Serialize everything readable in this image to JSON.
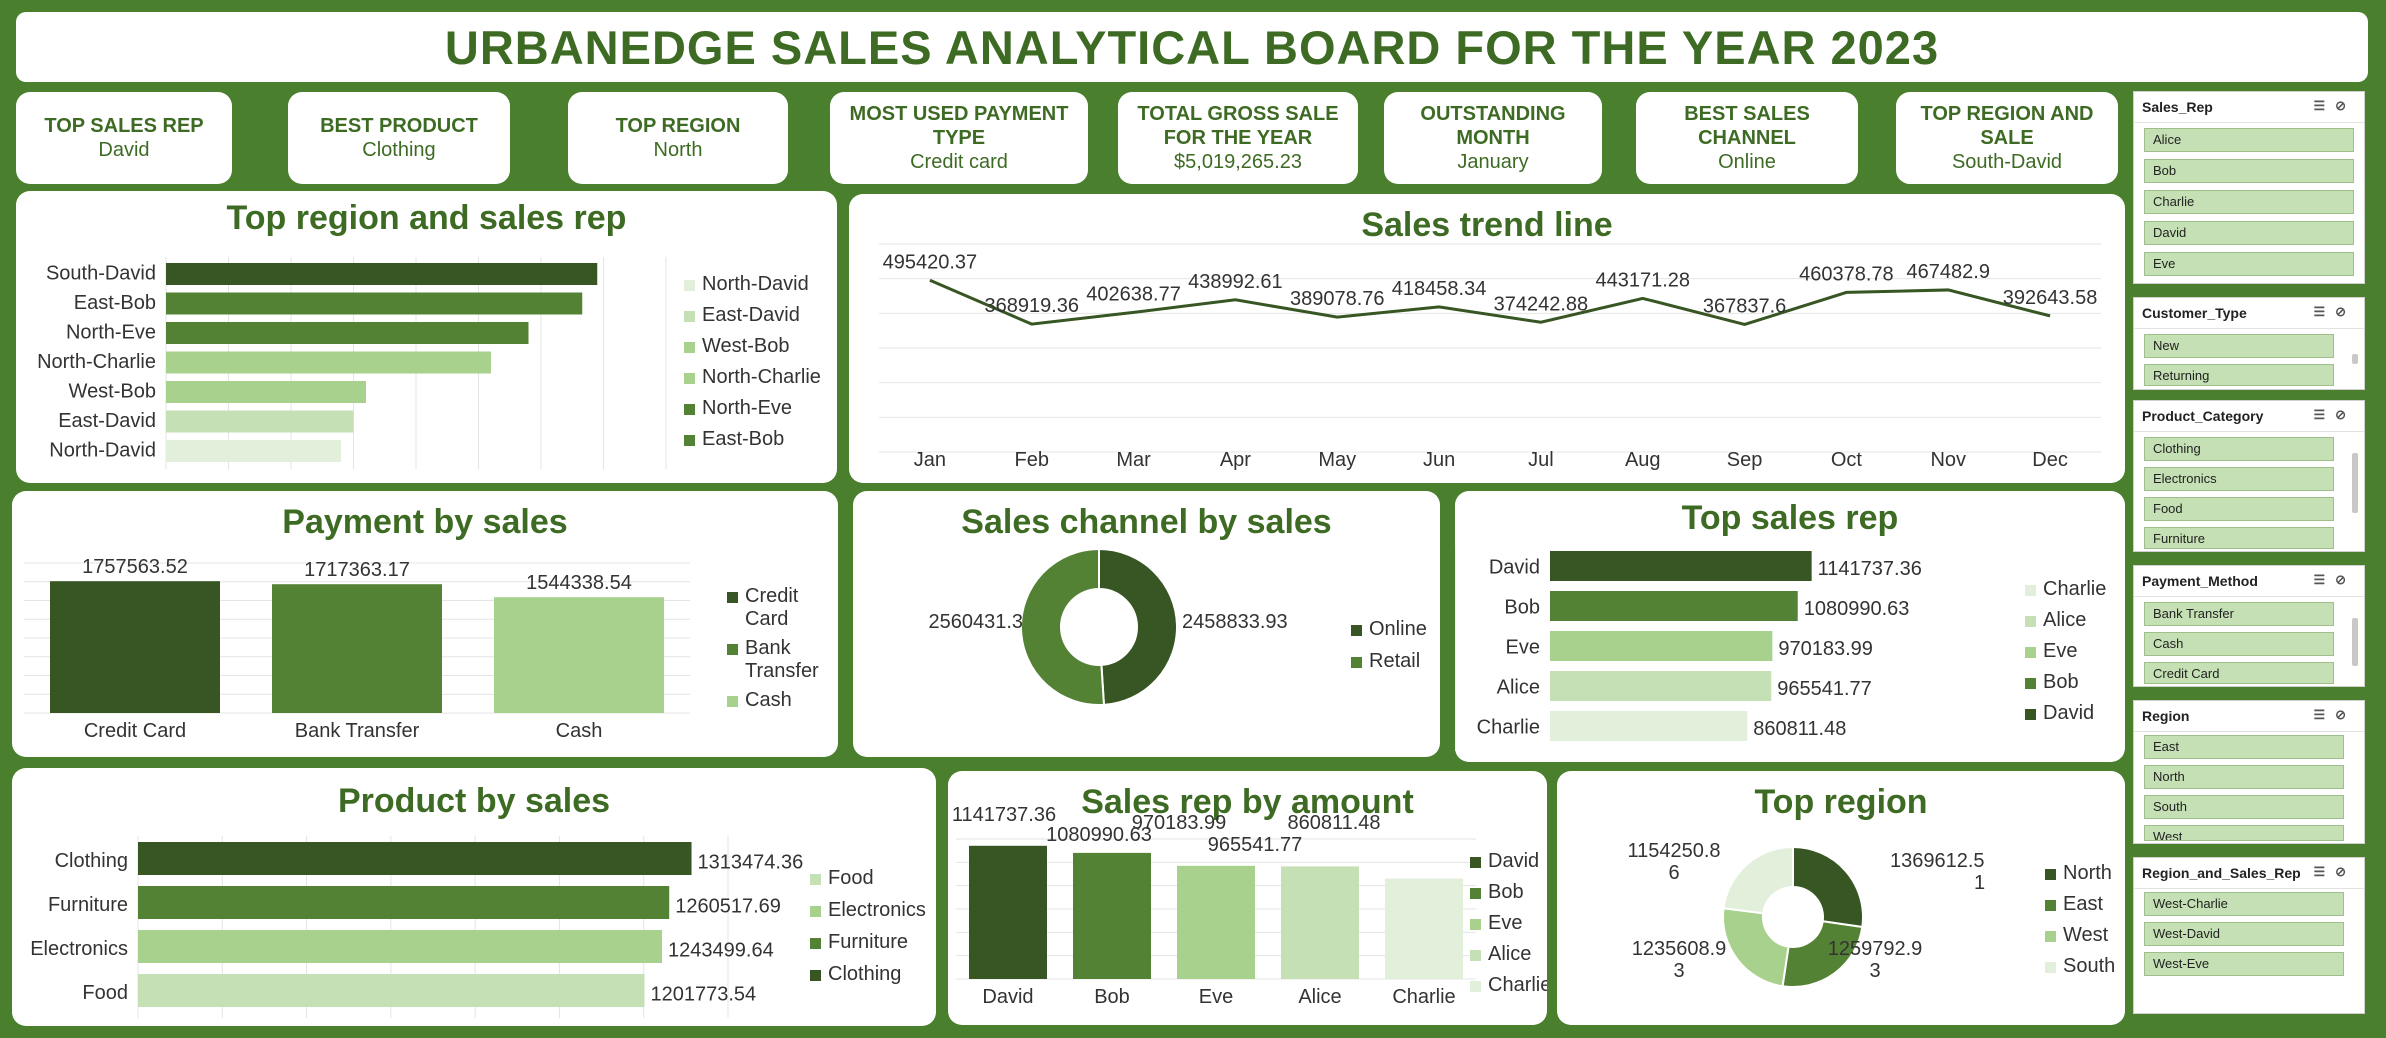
{
  "title": "URBANEDGE SALES ANALYTICAL BOARD FOR THE YEAR 2023",
  "kpis": [
    {
      "label": "TOP SALES REP",
      "value": "David"
    },
    {
      "label": "BEST PRODUCT",
      "value": "Clothing"
    },
    {
      "label": "TOP REGION",
      "value": "North"
    },
    {
      "label": "MOST USED PAYMENT TYPE",
      "value": "Credit card"
    },
    {
      "label": "TOTAL GROSS SALE FOR THE YEAR",
      "value": "$5,019,265.23"
    },
    {
      "label": "OUTSTANDING MONTH",
      "value": "January"
    },
    {
      "label": "BEST SALES CHANNEL",
      "value": "Online"
    },
    {
      "label": "TOP REGION AND SALE",
      "value": "South-David"
    }
  ],
  "colors": {
    "dark": "#375623",
    "mid": "#548235",
    "light": "#a9d18e",
    "pale": "#c5e0b4",
    "paler": "#e2efda",
    "title": "#3e6b24",
    "background": "#4a7f2e"
  },
  "chart_data": [
    {
      "id": "top-region-rep",
      "type": "bar",
      "title": "Top region and sales rep",
      "orientation": "horizontal",
      "categories": [
        "South-David",
        "East-Bob",
        "North-Eve",
        "North-Charlie",
        "West-Bob",
        "East-David",
        "North-David"
      ],
      "values": [
        345000,
        333000,
        290000,
        260000,
        160000,
        150000,
        140000
      ],
      "colors": [
        "#375623",
        "#548235",
        "#548235",
        "#a9d18e",
        "#a9d18e",
        "#c5e0b4",
        "#e2efda"
      ],
      "legend": [
        "North-David",
        "East-David",
        "West-Bob",
        "North-Charlie",
        "North-Eve",
        "East-Bob"
      ],
      "legend_colors": [
        "#e2efda",
        "#c5e0b4",
        "#a9d18e",
        "#a9d18e",
        "#548235",
        "#548235"
      ],
      "xlim": [
        0,
        400000
      ],
      "grid": true,
      "legend_position": "right"
    },
    {
      "id": "sales-trend",
      "type": "line",
      "title": "Sales trend line",
      "categories": [
        "Jan",
        "Feb",
        "Mar",
        "Apr",
        "May",
        "Jun",
        "Jul",
        "Aug",
        "Sep",
        "Oct",
        "Nov",
        "Dec"
      ],
      "values": [
        495420.37,
        368919.36,
        402638.77,
        438992.61,
        389078.76,
        418458.34,
        374242.88,
        443171.28,
        367837.6,
        460378.78,
        467482.9,
        392643.58
      ],
      "labels": [
        "495420.37",
        "368919.36",
        "402638.77",
        "438992.61",
        "389078.76",
        "418458.34",
        "374242.88",
        "443171.28",
        "367837.6",
        "460378.78",
        "467482.9",
        "392643.58"
      ],
      "ylim": [
        0,
        600000
      ],
      "grid": true
    },
    {
      "id": "payment-by-sales",
      "type": "bar",
      "title": "Payment by sales",
      "categories": [
        "Credit Card",
        "Bank Transfer",
        "Cash"
      ],
      "values": [
        1757563.52,
        1717363.17,
        1544338.54
      ],
      "labels": [
        "1757563.52",
        "1717363.17",
        "1544338.54"
      ],
      "colors": [
        "#375623",
        "#548235",
        "#a9d18e"
      ],
      "legend": [
        "Credit Card",
        "Bank Transfer",
        "Cash"
      ],
      "ylim": [
        0,
        2000000
      ],
      "legend_position": "right"
    },
    {
      "id": "sales-channel",
      "type": "pie",
      "title": "Sales channel  by sales",
      "donut": true,
      "categories": [
        "Online",
        "Retail"
      ],
      "values": [
        2458833.93,
        2560431.3
      ],
      "labels": [
        "2458833.93",
        "2560431.3"
      ],
      "colors": [
        "#375623",
        "#548235"
      ],
      "legend_position": "right"
    },
    {
      "id": "top-sales-rep",
      "type": "bar",
      "title": "Top sales rep",
      "orientation": "horizontal",
      "categories": [
        "David",
        "Bob",
        "Eve",
        "Alice",
        "Charlie"
      ],
      "values": [
        1141737.36,
        1080990.63,
        970183.99,
        965541.77,
        860811.48
      ],
      "labels": [
        "1141737.36",
        "1080990.63",
        "970183.99",
        "965541.77",
        "860811.48"
      ],
      "colors": [
        "#375623",
        "#548235",
        "#a9d18e",
        "#c5e0b4",
        "#e2efda"
      ],
      "legend": [
        "Charlie",
        "Alice",
        "Eve",
        "Bob",
        "David"
      ],
      "legend_colors": [
        "#e2efda",
        "#c5e0b4",
        "#a9d18e",
        "#548235",
        "#375623"
      ],
      "xlim": [
        0,
        1200000
      ],
      "legend_position": "right"
    },
    {
      "id": "product-by-sales",
      "type": "bar",
      "title": "Product by sales",
      "orientation": "horizontal",
      "categories": [
        "Clothing",
        "Furniture",
        "Electronics",
        "Food"
      ],
      "values": [
        1313474.36,
        1260517.69,
        1243499.64,
        1201773.54
      ],
      "labels": [
        "1313474.36",
        "1260517.69",
        "1243499.64",
        "1201773.54"
      ],
      "colors": [
        "#375623",
        "#548235",
        "#a9d18e",
        "#c5e0b4"
      ],
      "legend": [
        "Food",
        "Electronics",
        "Furniture",
        "Clothing"
      ],
      "legend_colors": [
        "#c5e0b4",
        "#a9d18e",
        "#548235",
        "#375623"
      ],
      "xlim": [
        0,
        1400000
      ],
      "legend_position": "right"
    },
    {
      "id": "rep-by-amount",
      "type": "bar",
      "title": "Sales rep by amount",
      "categories": [
        "David",
        "Bob",
        "Eve",
        "Alice",
        "Charlie"
      ],
      "values": [
        1141737.36,
        1080990.63,
        970183.99,
        965541.77,
        860811.48
      ],
      "labels": [
        "1141737.36",
        "1080990.63",
        "970183.99",
        "965541.77",
        "860811.48"
      ],
      "colors": [
        "#375623",
        "#548235",
        "#a9d18e",
        "#c5e0b4",
        "#e2efda"
      ],
      "legend": [
        "David",
        "Bob",
        "Eve",
        "Alice",
        "Charlie"
      ],
      "ylim": [
        0,
        1200000
      ],
      "legend_position": "right"
    },
    {
      "id": "top-region",
      "type": "pie",
      "title": "Top region",
      "donut": true,
      "categories": [
        "North",
        "East",
        "West",
        "South"
      ],
      "values": [
        1369612.51,
        1259792.93,
        1235608.93,
        1154250.86
      ],
      "label_lines": [
        [
          "1369612.5",
          "1"
        ],
        [
          "1259792.9",
          "3"
        ],
        [
          "1235608.9",
          "3"
        ],
        [
          "1154250.8",
          "6"
        ]
      ],
      "colors": [
        "#375623",
        "#548235",
        "#a9d18e",
        "#e2efda"
      ],
      "legend_position": "right"
    }
  ],
  "slicers": [
    {
      "title": "Sales_Rep",
      "items": [
        "Alice",
        "Bob",
        "Charlie",
        "David",
        "Eve"
      ]
    },
    {
      "title": "Customer_Type",
      "items": [
        "New",
        "Returning"
      ]
    },
    {
      "title": "Product_Category",
      "items": [
        "Clothing",
        "Electronics",
        "Food",
        "Furniture"
      ]
    },
    {
      "title": "Payment_Method",
      "items": [
        "Bank Transfer",
        "Cash",
        "Credit Card"
      ]
    },
    {
      "title": "Region",
      "items": [
        "East",
        "North",
        "South",
        "West"
      ]
    },
    {
      "title": "Region_and_Sales_Rep",
      "items": [
        "West-Charlie",
        "West-David",
        "West-Eve"
      ]
    }
  ],
  "slicer_icons": [
    "multi-select-icon",
    "clear-filter-icon"
  ]
}
